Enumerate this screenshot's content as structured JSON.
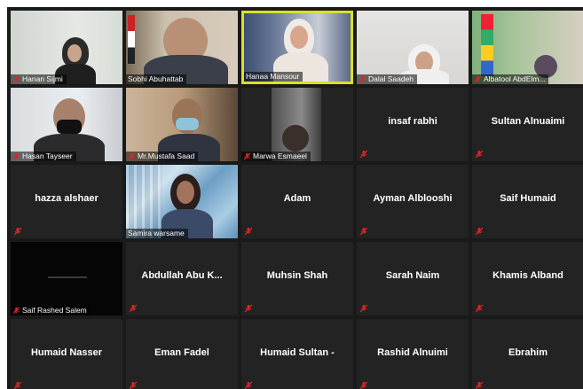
{
  "meeting": {
    "colors": {
      "active_speaker": "#d9e02a",
      "muted_red": "#e02424",
      "tile_bg": "#232323"
    },
    "participants": [
      {
        "name": "Hanan Sijmi",
        "video": true
      },
      {
        "name": "Sobhi Abuhattab",
        "video": true
      },
      {
        "name": "Hanaa Mansour",
        "video": true,
        "active": true
      },
      {
        "name": "Dalal Saadeh",
        "video": true
      },
      {
        "name": "Albatool AbdElm...",
        "video": true
      },
      {
        "name": "Hasan Tayseer",
        "video": true
      },
      {
        "name": "Mr.Mustafa Saad",
        "video": true
      },
      {
        "name": "Marwa Esmaeel",
        "video": true
      },
      {
        "name": "insaf rabhi",
        "video": false
      },
      {
        "name": "Sultan Alnuaimi",
        "video": false
      },
      {
        "name": "hazza alshaer",
        "video": false
      },
      {
        "name": "Samira warsame",
        "video": true
      },
      {
        "name": "Adam",
        "video": false
      },
      {
        "name": "Ayman Alblooshi",
        "video": false
      },
      {
        "name": "Saif Humaid",
        "video": false
      },
      {
        "name": "Saif Rashed Salem",
        "video": true
      },
      {
        "name": "Abdullah Abu K...",
        "video": false
      },
      {
        "name": "Muhsin Shah",
        "video": false
      },
      {
        "name": "Sarah Naim",
        "video": false
      },
      {
        "name": "Khamis Alband",
        "video": false
      },
      {
        "name": "Humaid Nasser",
        "video": false
      },
      {
        "name": "Eman Fadel",
        "video": false
      },
      {
        "name": "Humaid Sultan -",
        "video": false
      },
      {
        "name": "Rashid Alnuimi",
        "video": false
      },
      {
        "name": "Ebrahim",
        "video": false
      }
    ]
  }
}
